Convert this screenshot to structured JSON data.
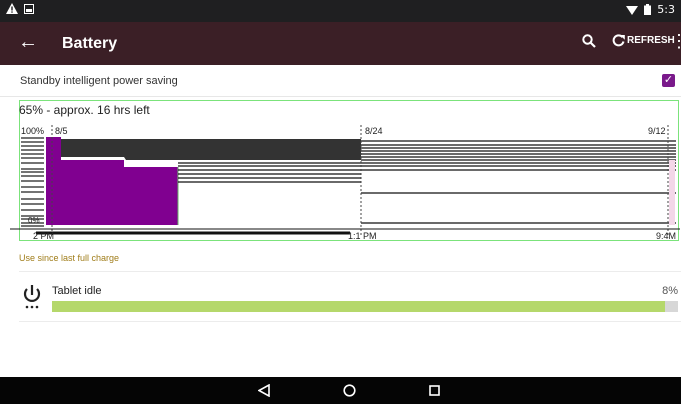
{
  "status_bar": {
    "clock": "5:3",
    "icons": [
      "warning-icon",
      "image-icon",
      "wifi-icon",
      "battery-icon"
    ]
  },
  "toolbar": {
    "title": "Battery",
    "refresh_label": "REFRESH",
    "icons": [
      "back-arrow-icon",
      "search-icon",
      "refresh-icon",
      "more-vert-icon"
    ]
  },
  "standby": {
    "label": "Standby intelligent power saving",
    "checked": true
  },
  "graph": {
    "summary": "65% - approx. 16 hrs left",
    "top_labels": [
      "100%",
      "8/5",
      "8/24",
      "9/12"
    ],
    "bottom_labels": [
      "2 PM",
      "1:1 PM",
      "9:4M"
    ],
    "low_label": "0%",
    "colors": {
      "level": "#800090",
      "dark": "#333333",
      "line": "#111111",
      "box": "#7be37b"
    }
  },
  "use_since": "Use since last full charge",
  "apps": [
    {
      "name": "Tablet idle",
      "percent": "8%",
      "fraction": 0.98,
      "icon": "power-icon"
    }
  ],
  "nav": {
    "icons": [
      "back-triangle-icon",
      "home-circle-icon",
      "recents-square-icon"
    ]
  },
  "colors": {
    "toolbar": "#3b1f26",
    "accent": "#7a198b",
    "bar": "#b5d86b",
    "link": "#a07d1a"
  }
}
